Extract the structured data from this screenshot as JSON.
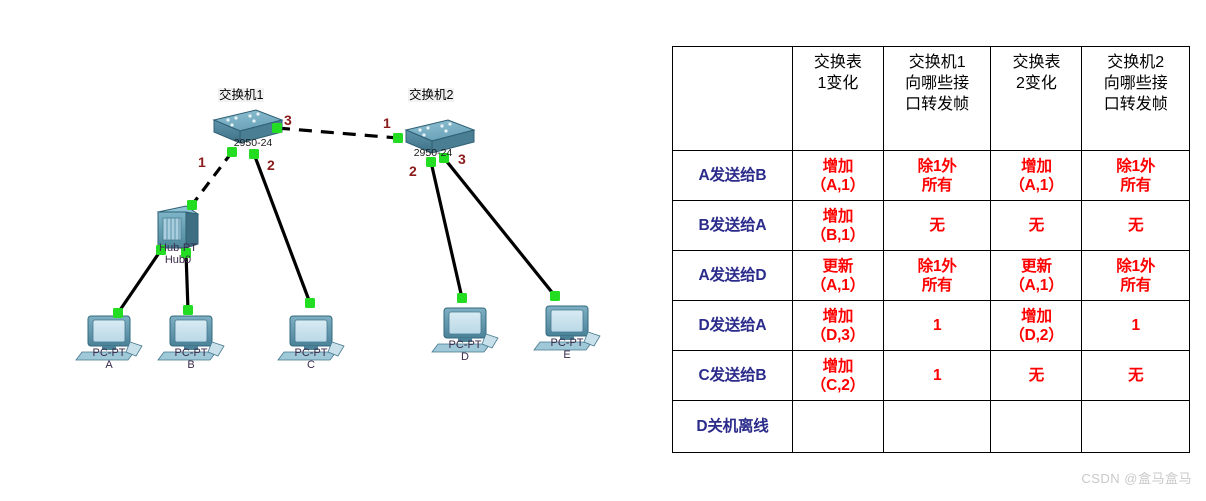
{
  "topology": {
    "switches": [
      {
        "title": "交换机1",
        "model": "2950-24",
        "ports": [
          "1",
          "2",
          "3"
        ]
      },
      {
        "title": "交换机2",
        "model": "2950-24",
        "ports": [
          "1",
          "2",
          "3"
        ]
      }
    ],
    "hub": {
      "name": "Hub-PT",
      "label": "Hub0"
    },
    "pcs": [
      {
        "name": "PC-PT",
        "label": "A"
      },
      {
        "name": "PC-PT",
        "label": "B"
      },
      {
        "name": "PC-PT",
        "label": "C"
      },
      {
        "name": "PC-PT",
        "label": "D"
      },
      {
        "name": "PC-PT",
        "label": "E"
      }
    ]
  },
  "table": {
    "headers": [
      "",
      "交换表1变化",
      "交换机1向哪些接口转发帧",
      "交换表2变化",
      "交换机2向哪些接口转发帧"
    ],
    "headers_wrapped": [
      "",
      "交换表\n1变化",
      "交换机1\n向哪些接\n口转发帧",
      "交换表\n2变化",
      "交换机2\n向哪些接\n口转发帧"
    ],
    "rows": [
      {
        "label": "A发送给B",
        "c1": "增加\n（A,1）",
        "c2": "除1外\n所有",
        "c3": "增加\n（A,1）",
        "c4": "除1外\n所有"
      },
      {
        "label": "B发送给A",
        "c1": "增加\n（B,1）",
        "c2": "无",
        "c3": "无",
        "c4": "无"
      },
      {
        "label": "A发送给D",
        "c1": "更新\n（A,1）",
        "c2": "除1外\n所有",
        "c3": "更新\n（A,1）",
        "c4": "除1外\n所有"
      },
      {
        "label": "D发送给A",
        "c1": "增加\n（D,3）",
        "c2": "1",
        "c3": "增加\n（D,2）",
        "c4": "1"
      },
      {
        "label": "C发送给B",
        "c1": "增加\n（C,2）",
        "c2": "1",
        "c3": "无",
        "c4": "无"
      },
      {
        "label": "D关机离线",
        "c1": "",
        "c2": "",
        "c3": "",
        "c4": ""
      }
    ]
  },
  "watermark": "CSDN @盒马盒马",
  "colors": {
    "row_label": "#2b2b8c",
    "cell_value": "#ff0000",
    "port_number": "#8b1a1a",
    "link_node": "#22dd22",
    "device_body": "#5f93a8"
  }
}
